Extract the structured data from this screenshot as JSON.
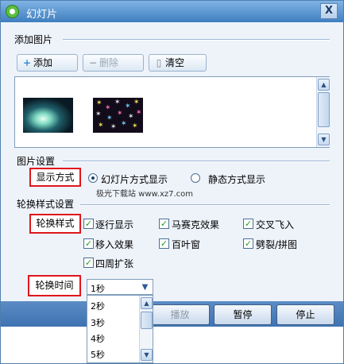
{
  "window": {
    "title": "幻灯片",
    "close_label": "X"
  },
  "add_images": {
    "section_title": "添加图片",
    "add_button": {
      "icon": "plus-icon",
      "glyph": "+",
      "label": "添加"
    },
    "delete_button": {
      "icon": "minus-icon",
      "glyph": "−",
      "label": "删除"
    },
    "clear_button": {
      "icon": "trash-icon",
      "glyph": "▯",
      "label": "清空"
    },
    "scroll_up": "▲",
    "scroll_down": "▼"
  },
  "image_settings": {
    "section_title": "图片设置",
    "display_mode_label": "显示方式",
    "options": [
      {
        "label": "幻灯片方式显示",
        "selected": true
      },
      {
        "label": "静态方式显示",
        "selected": false
      }
    ],
    "watermark": "极光下载站 www.xz7.com"
  },
  "transition_settings": {
    "section_title": "轮换样式设置",
    "style_label": "轮换样式",
    "styles": [
      {
        "label": "逐行显示",
        "checked": true
      },
      {
        "label": "马赛克效果",
        "checked": true
      },
      {
        "label": "交叉飞入",
        "checked": true
      },
      {
        "label": "移入效果",
        "checked": true
      },
      {
        "label": "百叶窗",
        "checked": true
      },
      {
        "label": "劈裂/拼图",
        "checked": true
      },
      {
        "label": "四周扩张",
        "checked": true
      }
    ],
    "check_glyph": "✓",
    "time_label": "轮换时间",
    "time_selected": "1秒",
    "time_options": [
      "2秒",
      "3秒",
      "4秒",
      "5秒"
    ],
    "dropdown_arrow": "▼"
  },
  "footer": {
    "play_button": "播放",
    "pause_button": "暂停",
    "stop_button": "停止"
  },
  "colors": {
    "accent": "#3f72b2",
    "highlight_border": "#e0161c",
    "check": "#21a121"
  }
}
